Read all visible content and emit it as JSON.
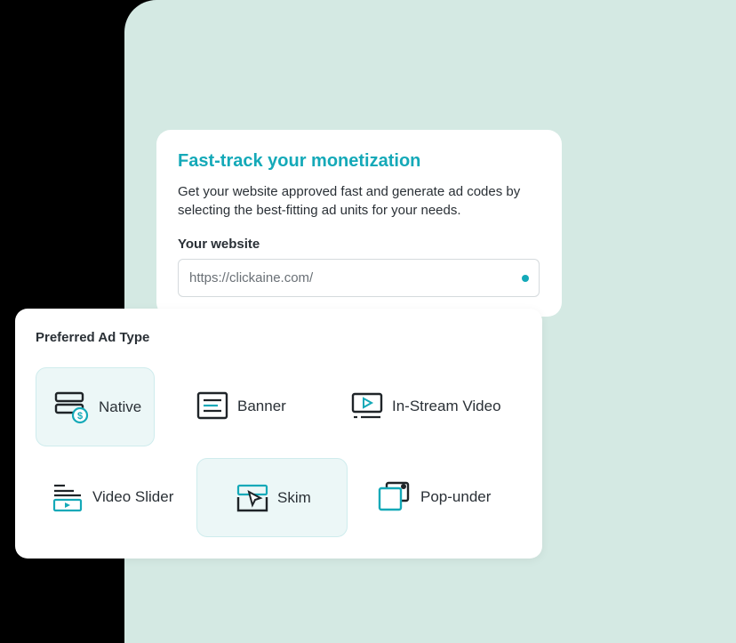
{
  "colors": {
    "accent": "#14a9b8",
    "background": "#d4e9e3",
    "selected_bg": "#ecf7f7",
    "text": "#2a3036"
  },
  "onboarding": {
    "title": "Fast-track your monetization",
    "description": "Get your website approved fast and generate ad codes by selecting the best-fitting ad units for your needs.",
    "website_label": "Your website",
    "website_placeholder": "https://clickaine.com/"
  },
  "ad_type": {
    "section_title": "Preferred Ad Type",
    "options": [
      {
        "label": "Native",
        "icon": "native-icon",
        "selected": true
      },
      {
        "label": "Banner",
        "icon": "banner-icon",
        "selected": false
      },
      {
        "label": "In-Stream Video",
        "icon": "in-stream-video-icon",
        "selected": false
      },
      {
        "label": "Video Slider",
        "icon": "video-slider-icon",
        "selected": false
      },
      {
        "label": "Skim",
        "icon": "skim-icon",
        "selected": true
      },
      {
        "label": "Pop-under",
        "icon": "pop-under-icon",
        "selected": false
      }
    ]
  }
}
